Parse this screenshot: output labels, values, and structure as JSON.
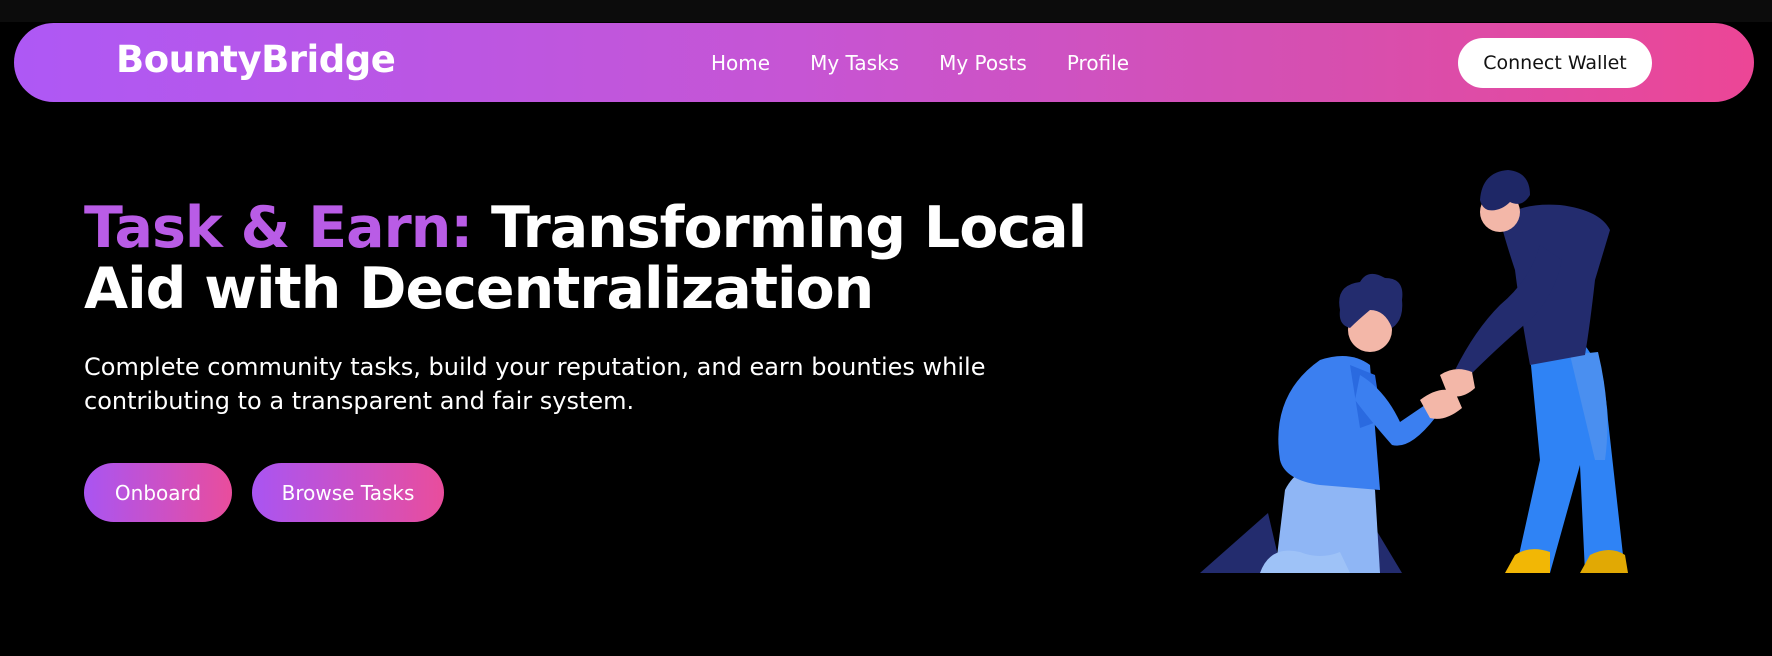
{
  "app": {
    "brand": "BountyBridge"
  },
  "nav": {
    "links": [
      "Home",
      "My Tasks",
      "My Posts",
      "Profile"
    ],
    "connect_wallet": "Connect Wallet"
  },
  "hero": {
    "title_accent": "Task & Earn:",
    "title_rest": " Transforming Local Aid with Decentralization",
    "subtitle": "Complete community tasks, build your reputation, and earn bounties while contributing to a transparent and fair system.",
    "buttons": {
      "onboard": "Onboard",
      "browse": "Browse Tasks"
    }
  },
  "illustration": {
    "icon": "helping-hand-illustration"
  },
  "colors": {
    "accent_purple": "#b95ce6",
    "gradient_start": "#ae58f5",
    "gradient_end": "#ec4696",
    "background": "#000000"
  }
}
